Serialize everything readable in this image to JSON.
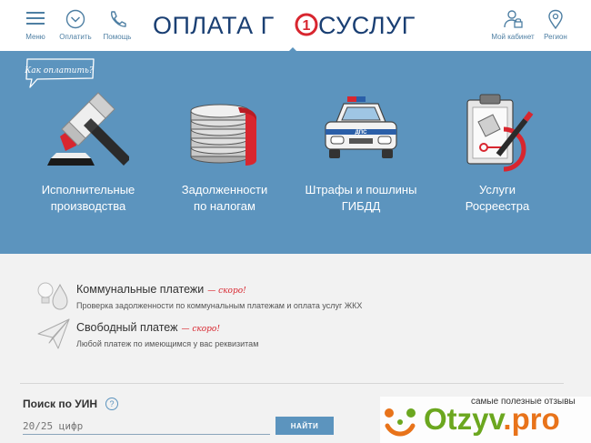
{
  "header": {
    "menu_label": "Меню",
    "pay_label": "Оплатить",
    "help_label": "Помощь",
    "logo_left": "ОПЛАТА Г",
    "logo_digit": "1",
    "logo_right": "СУСЛУГ",
    "cabinet_label": "Мой кабинет",
    "region_label": "Регион",
    "accent_color": "#1a3f73",
    "logo_red": "#d8262f"
  },
  "hero": {
    "how_to_pay": "Как оплатить?",
    "tiles": [
      {
        "line1": "Исполнительные",
        "line2": "производства",
        "icon": "gavel-icon"
      },
      {
        "line1": "Задолженности",
        "line2": "по налогам",
        "icon": "coins-icon"
      },
      {
        "line1": "Штрафы и пошлины",
        "line2": "ГИБДД",
        "icon": "police-car-icon"
      },
      {
        "line1": "Услуги",
        "line2": "Росреестра",
        "icon": "clipboard-icon"
      }
    ],
    "car_text": "ДПС",
    "bg_color": "#5c94be"
  },
  "services": [
    {
      "title": "Коммунальные платежи",
      "soon": "— скоро!",
      "desc": "Проверка задолженности по коммунальным платежам и оплата услуг ЖКХ",
      "icon": "bulb-drop-icon"
    },
    {
      "title": "Свободный платеж",
      "soon": "— скоро!",
      "desc": "Любой платеж по имеющимся у вас реквизитам",
      "icon": "paper-plane-icon"
    }
  ],
  "uin": {
    "title": "Поиск по УИН",
    "help": "?",
    "placeholder": "20/25 цифр",
    "button": "НАЙТИ"
  },
  "watermark": {
    "tagline": "самые полезные отзывы",
    "name": "Otzyv",
    "suffix": ".pro"
  }
}
